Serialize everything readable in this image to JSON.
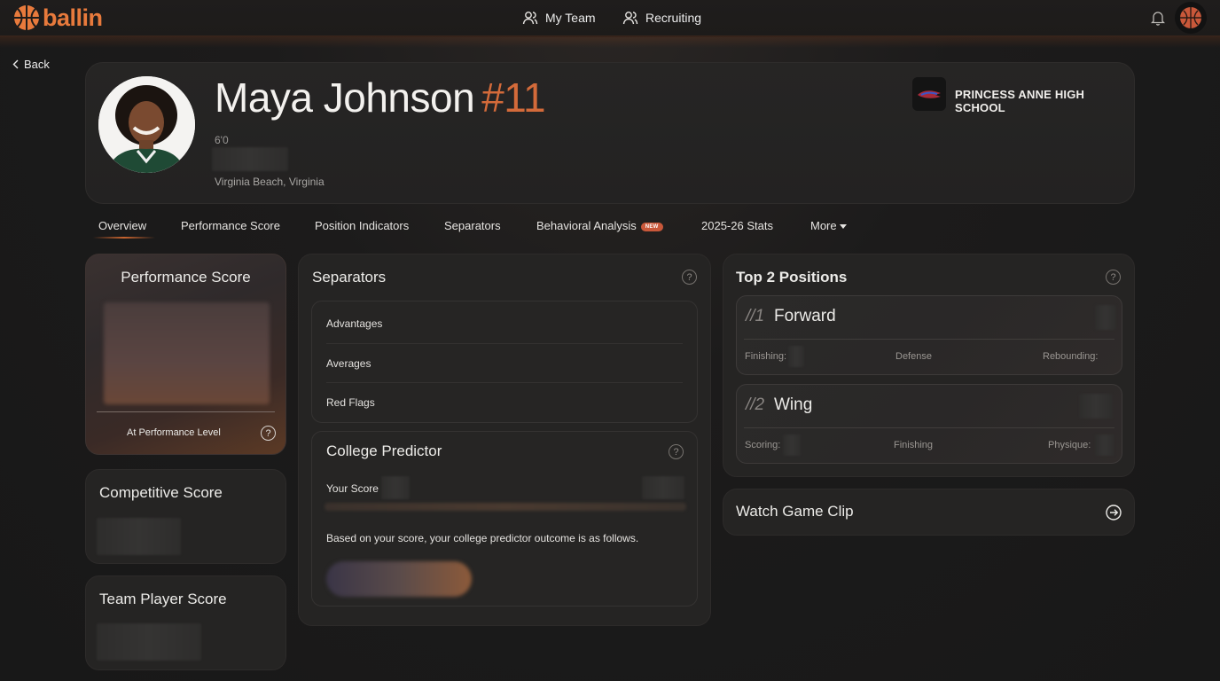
{
  "app": {
    "brand": "ballin",
    "accent_color": "#e87a3c"
  },
  "nav": {
    "my_team": "My Team",
    "recruiting": "Recruiting"
  },
  "back_label": "Back",
  "player": {
    "name": "Maya Johnson",
    "number": "#11",
    "height": "6'0",
    "location": "Virginia Beach, Virginia",
    "school": "PRINCESS ANNE HIGH SCHOOL"
  },
  "tabs": [
    {
      "label": "Overview",
      "active": true
    },
    {
      "label": "Performance Score"
    },
    {
      "label": "Position Indicators"
    },
    {
      "label": "Separators"
    },
    {
      "label": "Behavioral Analysis",
      "badge": "NEW"
    },
    {
      "label": "2025-26 Stats"
    },
    {
      "label": "More"
    }
  ],
  "performance_card": {
    "title": "Performance Score",
    "footer_label": "At Performance Level",
    "help": "?"
  },
  "competitive_card": {
    "title": "Competitive Score"
  },
  "team_player_card": {
    "title": "Team Player Score"
  },
  "separators_card": {
    "title": "Separators",
    "help": "?",
    "items": [
      "Advantages",
      "Averages",
      "Red Flags"
    ]
  },
  "college_predictor": {
    "title": "College Predictor",
    "help": "?",
    "score_label": "Your Score",
    "description": "Based on your score, your college predictor outcome is as follows."
  },
  "positions_card": {
    "title": "Top 2 Positions",
    "help": "?",
    "positions": [
      {
        "rank": "//1",
        "name": "Forward",
        "attrs": [
          "Finishing:",
          "Defense",
          "Rebounding:"
        ]
      },
      {
        "rank": "//2",
        "name": "Wing",
        "attrs": [
          "Scoring:",
          "Finishing",
          "Physique:"
        ]
      }
    ]
  },
  "game_clip": {
    "title": "Watch Game Clip"
  }
}
